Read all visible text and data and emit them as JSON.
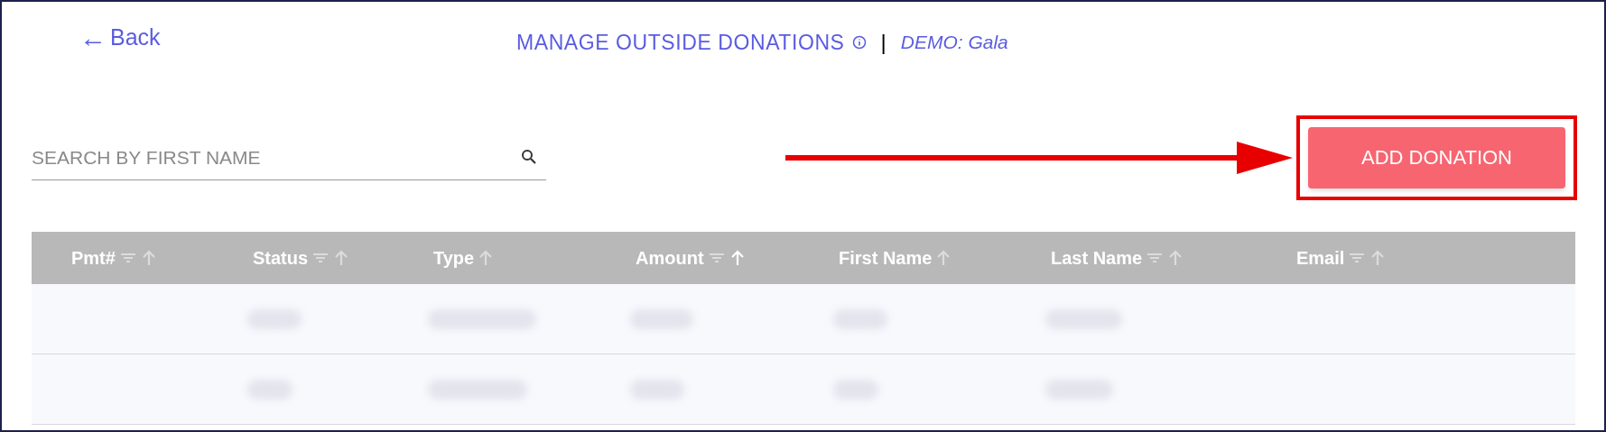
{
  "back_link": {
    "arrow": "←",
    "label": "Back"
  },
  "title": {
    "heading": "MANAGE OUTSIDE DONATIONS",
    "separator": "|",
    "event": "DEMO: Gala"
  },
  "search": {
    "placeholder": "SEARCH BY FIRST NAME"
  },
  "add_button": {
    "label": "ADD DONATION"
  },
  "annotation": {
    "arrow": true,
    "highlight_box": true
  },
  "table": {
    "columns": [
      {
        "label": "Pmt#",
        "filterable": true,
        "sorted": false
      },
      {
        "label": "Status",
        "filterable": true,
        "sorted": false
      },
      {
        "label": "Type",
        "filterable": false,
        "sorted": false
      },
      {
        "label": "Amount",
        "filterable": true,
        "sorted": true
      },
      {
        "label": "First Name",
        "filterable": false,
        "sorted": false
      },
      {
        "label": "Last Name",
        "filterable": true,
        "sorted": false
      },
      {
        "label": "Email",
        "filterable": true,
        "sorted": false
      }
    ],
    "rows": [
      {
        "kind": "blurred"
      },
      {
        "kind": "blurred"
      }
    ]
  }
}
